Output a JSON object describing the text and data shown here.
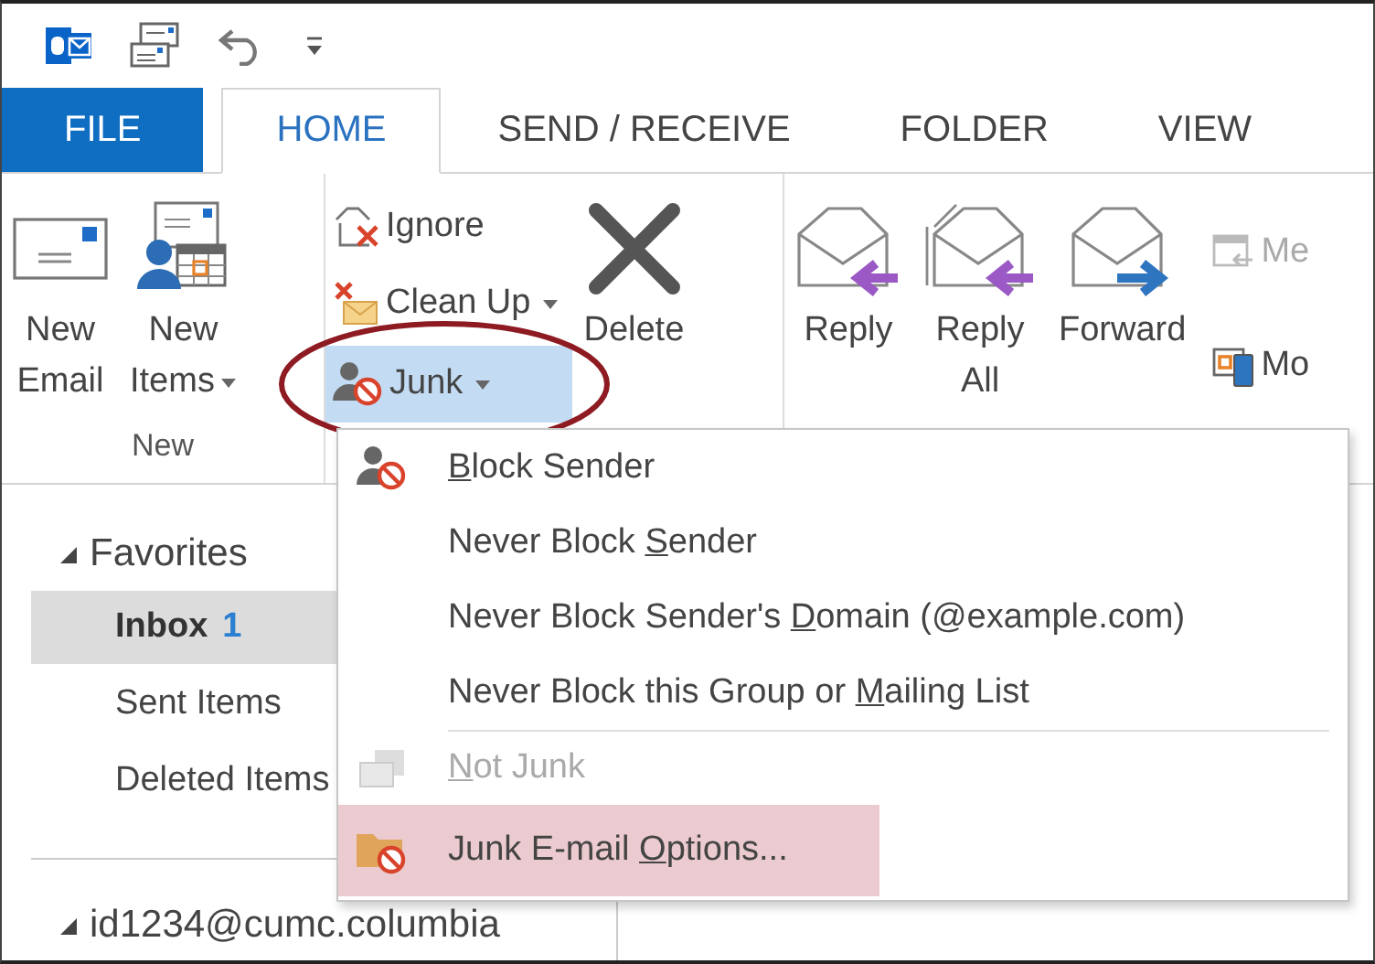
{
  "tabs": [
    {
      "label": "FILE",
      "kind": "file",
      "selected": false
    },
    {
      "label": "HOME",
      "kind": "tab",
      "selected": true
    },
    {
      "label": "SEND / RECEIVE",
      "kind": "tab",
      "selected": false
    },
    {
      "label": "FOLDER",
      "kind": "tab",
      "selected": false
    },
    {
      "label": "VIEW",
      "kind": "tab",
      "selected": false
    }
  ],
  "ribbon": {
    "groups": [
      {
        "label": "New",
        "buttons": [
          {
            "kind": "large",
            "lines": [
              "New",
              "Email"
            ],
            "has_menu": false
          },
          {
            "kind": "large",
            "lines": [
              "New",
              "Items"
            ],
            "has_menu": true
          }
        ]
      },
      {
        "buttons": [
          {
            "kind": "small",
            "lines": [
              "Ignore"
            ],
            "has_menu": false,
            "pressed": false
          },
          {
            "kind": "small",
            "lines": [
              "Clean Up"
            ],
            "has_menu": true,
            "pressed": false
          },
          {
            "kind": "small",
            "lines": [
              "Junk"
            ],
            "has_menu": true,
            "pressed": true
          },
          {
            "kind": "large",
            "lines": [
              "Delete"
            ],
            "has_menu": false
          }
        ]
      },
      {
        "buttons": [
          {
            "kind": "large",
            "lines": [
              "Reply"
            ],
            "has_menu": false
          },
          {
            "kind": "large",
            "lines": [
              "Reply",
              "All"
            ],
            "has_menu": false
          },
          {
            "kind": "large",
            "lines": [
              "Forward"
            ],
            "has_menu": false
          },
          {
            "kind": "small",
            "lines": [
              "Me"
            ],
            "has_menu": false,
            "disabled": true
          },
          {
            "kind": "small",
            "lines": [
              "Mo"
            ],
            "has_menu": false,
            "disabled": false
          }
        ]
      }
    ]
  },
  "nav": {
    "favorites": {
      "label": "Favorites",
      "expanded": true,
      "items": [
        {
          "label": "Inbox",
          "count": "1",
          "selected": true
        },
        {
          "label": "Sent Items",
          "selected": false
        },
        {
          "label": "Deleted Items",
          "selected": false
        }
      ]
    },
    "account": {
      "label": "id1234@cumc.columbia",
      "expanded": true
    }
  },
  "junk_menu": {
    "items": [
      {
        "key": "B",
        "post": "lock Sender",
        "disabled": false,
        "highlighted": false,
        "separator_before": false
      },
      {
        "pre": "Never Block ",
        "key": "S",
        "post": "ender",
        "disabled": false,
        "highlighted": false,
        "separator_before": false
      },
      {
        "pre": "Never Block Sender's ",
        "key": "D",
        "post": "omain (@example.com)",
        "disabled": false,
        "highlighted": false,
        "separator_before": false
      },
      {
        "pre": "Never Block this Group or ",
        "key": "M",
        "post": "ailing List",
        "disabled": false,
        "highlighted": false,
        "separator_before": false
      },
      {
        "key": "N",
        "post": "ot Junk",
        "disabled": true,
        "highlighted": false,
        "separator_before": true
      },
      {
        "pre": "Junk E-mail ",
        "key": "O",
        "post": "ptions...",
        "disabled": false,
        "highlighted": true,
        "separator_before": false
      }
    ]
  }
}
